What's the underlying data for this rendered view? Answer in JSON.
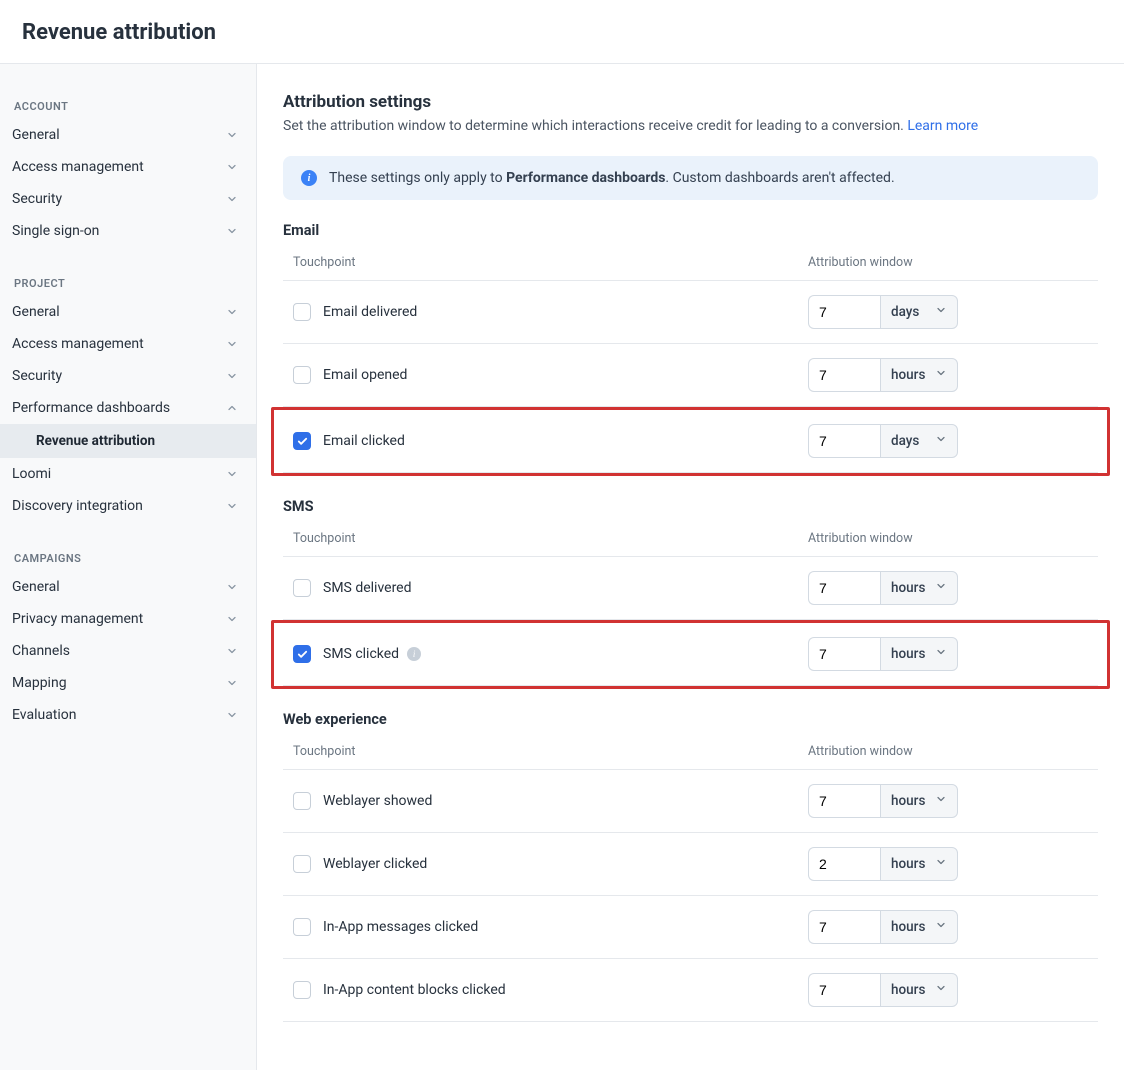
{
  "header": {
    "title": "Revenue attribution"
  },
  "sidebar": {
    "groups": [
      {
        "label": "ACCOUNT",
        "items": [
          {
            "label": "General",
            "expanded": false
          },
          {
            "label": "Access management",
            "expanded": false
          },
          {
            "label": "Security",
            "expanded": false
          },
          {
            "label": "Single sign-on",
            "expanded": false
          }
        ]
      },
      {
        "label": "PROJECT",
        "items": [
          {
            "label": "General",
            "expanded": false
          },
          {
            "label": "Access management",
            "expanded": false
          },
          {
            "label": "Security",
            "expanded": false
          },
          {
            "label": "Performance dashboards",
            "expanded": true,
            "children": [
              {
                "label": "Revenue attribution",
                "active": true
              }
            ]
          },
          {
            "label": "Loomi",
            "expanded": false
          },
          {
            "label": "Discovery integration",
            "expanded": false
          }
        ]
      },
      {
        "label": "CAMPAIGNS",
        "items": [
          {
            "label": "General",
            "expanded": false
          },
          {
            "label": "Privacy management",
            "expanded": false
          },
          {
            "label": "Channels",
            "expanded": false
          },
          {
            "label": "Mapping",
            "expanded": false
          },
          {
            "label": "Evaluation",
            "expanded": false
          }
        ]
      }
    ]
  },
  "main": {
    "title": "Attribution settings",
    "subtitle_prefix": "Set the attribution window to determine which interactions receive credit for leading to a conversion. ",
    "learn_more": "Learn more",
    "banner_prefix": "These settings only apply to ",
    "banner_bold": "Performance dashboards",
    "banner_suffix": ". Custom dashboards aren't affected.",
    "col_touchpoint": "Touchpoint",
    "col_attribution": "Attribution window",
    "sections": [
      {
        "title": "Email",
        "rows": [
          {
            "label": "Email delivered",
            "checked": false,
            "value": "7",
            "unit": "days"
          },
          {
            "label": "Email opened",
            "checked": false,
            "value": "7",
            "unit": "hours"
          },
          {
            "label": "Email clicked",
            "checked": true,
            "value": "7",
            "unit": "days",
            "highlight": true
          }
        ]
      },
      {
        "title": "SMS",
        "rows": [
          {
            "label": "SMS delivered",
            "checked": false,
            "value": "7",
            "unit": "hours"
          },
          {
            "label": "SMS clicked",
            "checked": true,
            "value": "7",
            "unit": "hours",
            "highlight": true,
            "info_icon": true
          }
        ]
      },
      {
        "title": "Web experience",
        "rows": [
          {
            "label": "Weblayer showed",
            "checked": false,
            "value": "7",
            "unit": "hours"
          },
          {
            "label": "Weblayer clicked",
            "checked": false,
            "value": "2",
            "unit": "hours"
          },
          {
            "label": "In-App messages clicked",
            "checked": false,
            "value": "7",
            "unit": "hours"
          },
          {
            "label": "In-App content blocks clicked",
            "checked": false,
            "value": "7",
            "unit": "hours"
          }
        ]
      }
    ]
  }
}
